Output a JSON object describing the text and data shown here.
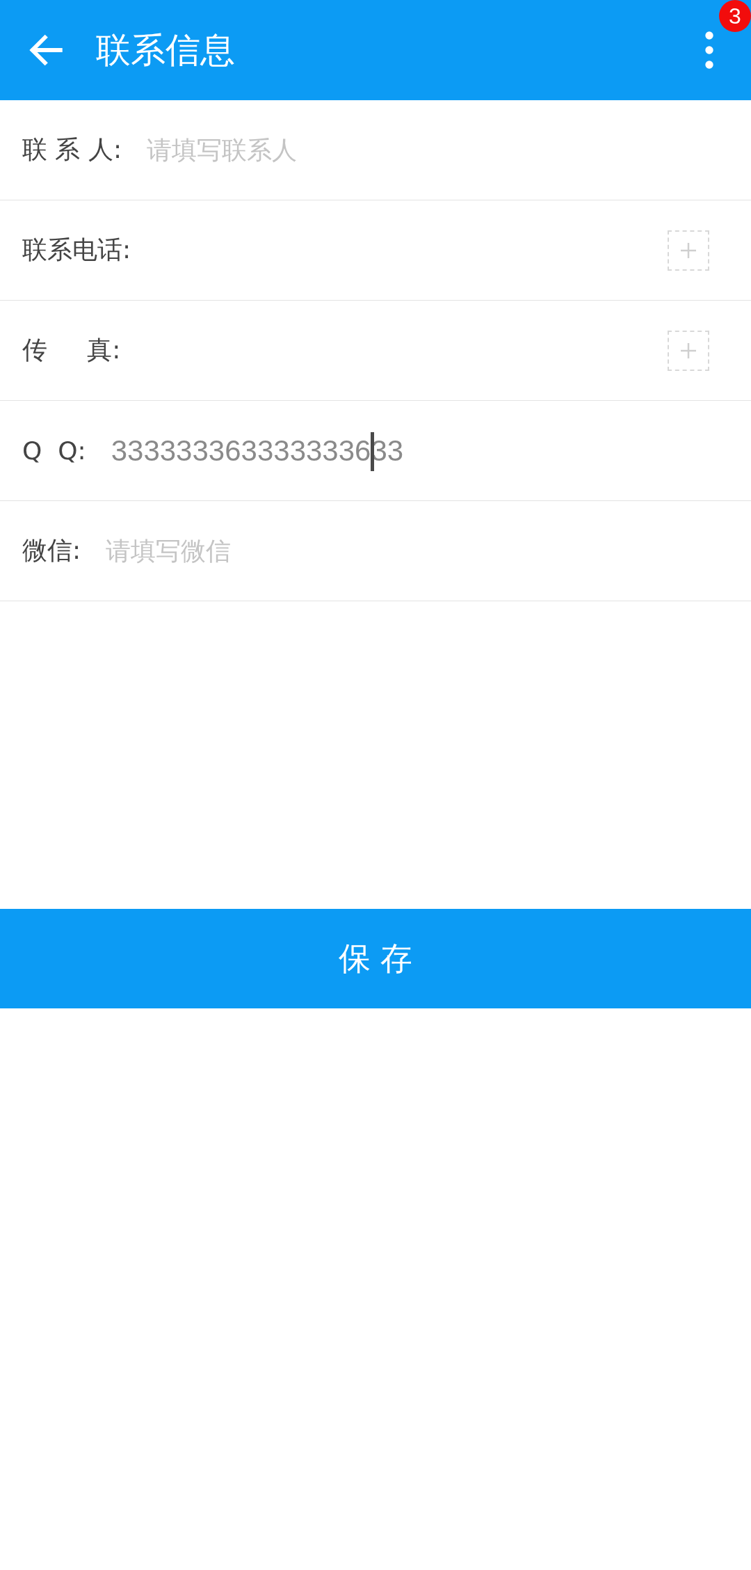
{
  "app_bar": {
    "title": "联系信息",
    "badge": "3"
  },
  "fields": [
    {
      "kind": "text",
      "label": "联 系 人:",
      "placeholder": "请填写联系人"
    },
    {
      "kind": "add",
      "label": "联系电话:"
    },
    {
      "kind": "add",
      "label": "传     真:"
    },
    {
      "kind": "text",
      "label": "Q  Q:",
      "value": "333333363333333633",
      "focused": true
    },
    {
      "kind": "text",
      "label": "微信:",
      "placeholder": "请填写微信"
    }
  ],
  "save_button": "保 存"
}
